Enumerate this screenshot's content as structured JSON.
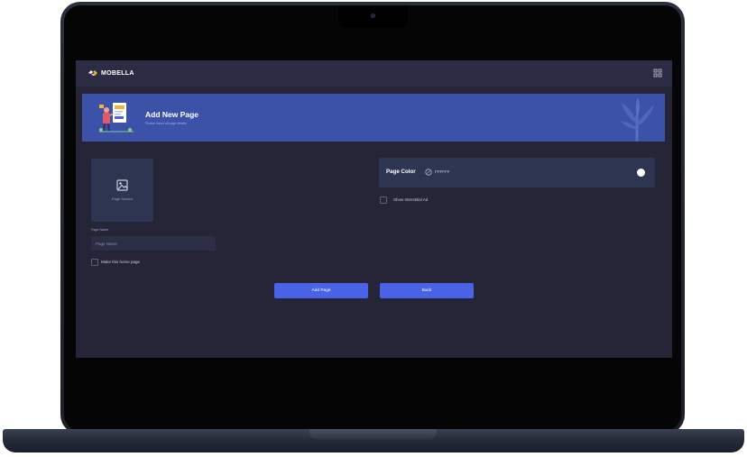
{
  "app": {
    "brand_name": "MOBELLA",
    "brand_accent": "#f2b233"
  },
  "banner": {
    "title": "Add New Page",
    "subtitle": "Please insert all page details",
    "background": "#3b52a8"
  },
  "form": {
    "upload_label": "Page Screen",
    "page_name_label": "Page Name",
    "page_name_placeholder": "Page Name",
    "page_name_value": "",
    "home_page_checkbox_label": "Make this home page",
    "home_page_checked": false,
    "page_color_label": "Page Color",
    "page_color_value": "FFFFFF",
    "interstitial_checkbox_label": "Show Interstitial Ad",
    "interstitial_checked": false
  },
  "buttons": {
    "add_label": "Add Page",
    "back_label": "Back"
  },
  "icons": {
    "logo": "mobella-logo-icon",
    "grid": "grid-icon",
    "upload": "image-upload-icon",
    "color_picker": "color-picker-icon"
  },
  "colors": {
    "screen_bg": "#252537",
    "topbar_bg": "#2c2d44",
    "button_primary": "#4a63e6",
    "card_bg": "#2e3550"
  }
}
